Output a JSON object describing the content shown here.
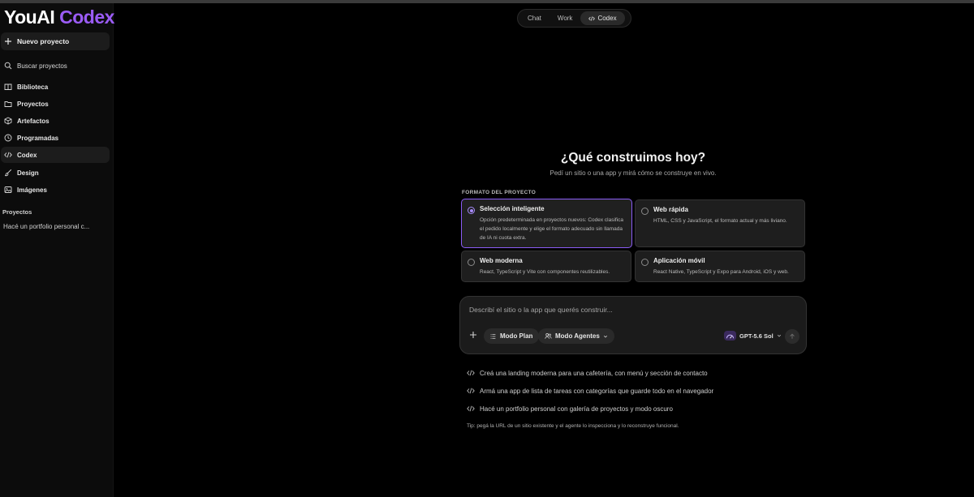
{
  "brand": {
    "name_white": "YouAI",
    "name_purple": "Codex",
    "purple": "#9b5cf6"
  },
  "sidebar": {
    "new_project": "Nuevo proyecto",
    "search": "Buscar proyectos",
    "items": [
      {
        "label": "Biblioteca",
        "icon": "book-icon"
      },
      {
        "label": "Proyectos",
        "icon": "folder-icon"
      },
      {
        "label": "Artefactos",
        "icon": "cube-icon"
      },
      {
        "label": "Programadas",
        "icon": "clock-icon"
      },
      {
        "label": "Codex",
        "icon": "code-icon",
        "active": true
      },
      {
        "label": "Design",
        "icon": "brush-icon"
      },
      {
        "label": "Imágenes",
        "icon": "image-icon"
      }
    ],
    "section_label": "Proyectos",
    "recent": [
      "Hacé un portfolio personal c..."
    ]
  },
  "tabs": {
    "items": [
      "Chat",
      "Work",
      "Codex"
    ],
    "active": "Codex"
  },
  "main": {
    "headline": "¿Qué construimos hoy?",
    "subline": "Pedí un sitio o una app y mirá cómo se construye en vivo.",
    "format_label": "FORMATO DEL PROYECTO",
    "cards": [
      {
        "title": "Selección inteligente",
        "desc": "Opción predeterminada en proyectos nuevos: Codex clasifica el pedido localmente y elige el formato adecuado sin llamada de IA ni cuota extra.",
        "selected": true
      },
      {
        "title": "Web rápida",
        "desc": "HTML, CSS y JavaScript, el formato actual y más liviano.",
        "selected": false
      },
      {
        "title": "Web moderna",
        "desc": "React, TypeScript y Vite con componentes reutilizables.",
        "selected": false
      },
      {
        "title": "Aplicación móvil",
        "desc": "React Native, TypeScript y Expo para Android, iOS y web.",
        "selected": false
      }
    ]
  },
  "composer": {
    "placeholder": "Describí el sitio o la app que querés construir...",
    "plan_label": "Modo Plan",
    "agents_label": "Modo Agentes",
    "model_label": "GPT-5.6 Sol"
  },
  "suggestions": [
    "Creá una landing moderna para una cafetería, con menú y sección de contacto",
    "Armá una app de lista de tareas con categorías que guarde todo en el navegador",
    "Hacé un portfolio personal con galería de proyectos y modo oscuro"
  ],
  "tip": "Tip: pegá la URL de un sitio existente y el agente lo inspecciona y lo reconstruye funcional."
}
